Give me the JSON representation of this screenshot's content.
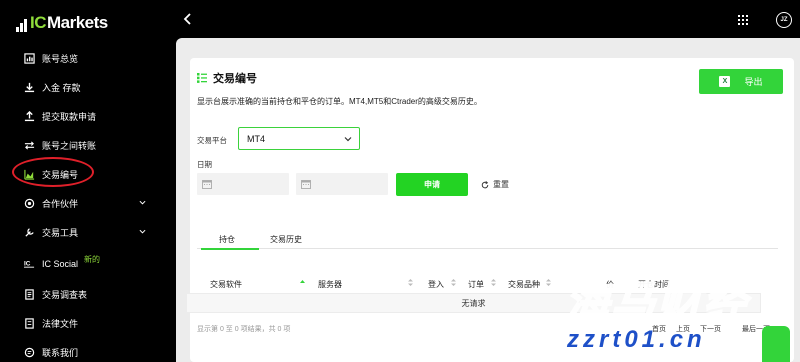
{
  "brand": {
    "ic": "IC",
    "markets": "Markets"
  },
  "sidebar": {
    "items": [
      {
        "label": "账号总览",
        "icon": "dashboard-icon"
      },
      {
        "label": "入金 存款",
        "icon": "deposit-icon"
      },
      {
        "label": "提交取款申请",
        "icon": "withdraw-icon"
      },
      {
        "label": "账号之间转账",
        "icon": "transfer-icon"
      },
      {
        "label": "交易编号",
        "icon": "chart-area-icon"
      },
      {
        "label": "合作伙伴",
        "icon": "partner-icon"
      },
      {
        "label": "交易工具",
        "icon": "tools-icon"
      },
      {
        "label": "IC Social",
        "icon": "ic-social-icon",
        "badge": "新的"
      },
      {
        "label": "交易调查表",
        "icon": "survey-icon"
      },
      {
        "label": "法律文件",
        "icon": "legal-icon"
      },
      {
        "label": "联系我们",
        "icon": "contact-icon"
      }
    ]
  },
  "topbar": {
    "avatar_initials": "JZ"
  },
  "page": {
    "title": "交易编号",
    "export_label": "导出",
    "export_icon_text": "X",
    "description": "显示台展示准确的当前持仓和平仓的订单。MT4,MT5和Ctrader的高级交易历史。"
  },
  "filters": {
    "platform_label": "交易平台",
    "platform_value": "MT4",
    "date_label": "日期",
    "apply_label": "申请",
    "reset_label": "重置"
  },
  "tabs": [
    {
      "label": "持仓"
    },
    {
      "label": "交易历史"
    }
  ],
  "table": {
    "columns": [
      "交易软件",
      "服务器",
      "登入",
      "订单",
      "交易品种",
      "价",
      "开仓时间"
    ],
    "empty_text": "无请求",
    "footer_info": "显示第 0 至 0 项结果，共 0 项",
    "pager": [
      "首页",
      "上页",
      "下一页",
      "最后一页"
    ]
  },
  "watermark": {
    "big": "海马财经",
    "url": "zzrt01.cn"
  },
  "colors": {
    "accent": "#33d43a",
    "ring": "#e0202a",
    "sidebar": "#000000"
  }
}
